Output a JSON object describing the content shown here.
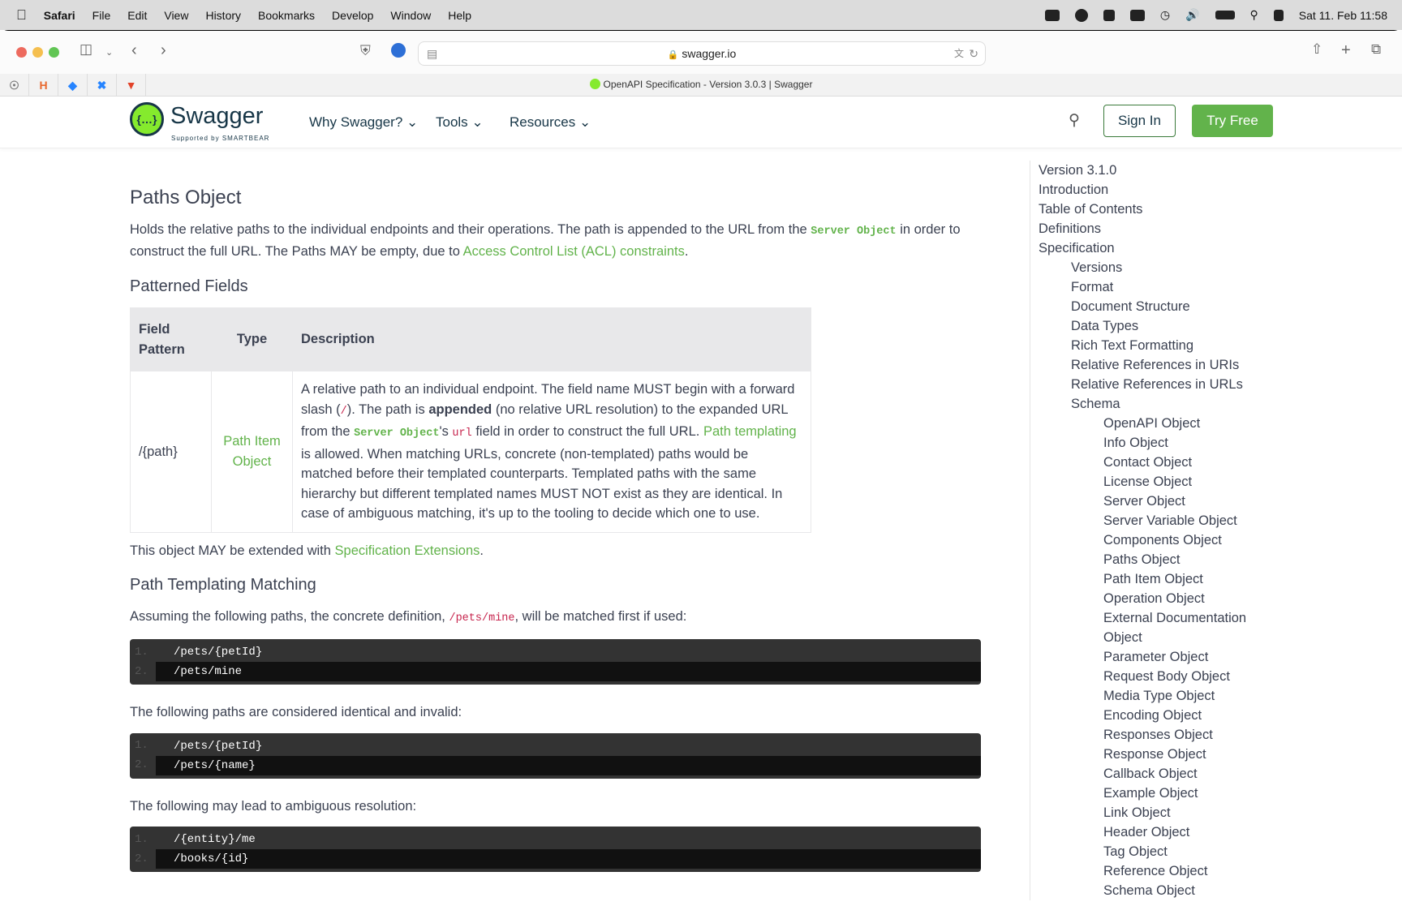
{
  "menubar": {
    "app": "Safari",
    "items": [
      "File",
      "Edit",
      "View",
      "History",
      "Bookmarks",
      "Develop",
      "Window",
      "Help"
    ],
    "datetime": "Sat 11. Feb 11:58"
  },
  "browser": {
    "url": "swagger.io",
    "tab_title": "OpenAPI Specification - Version 3.0.3 | Swagger"
  },
  "header": {
    "brand": "Swagger",
    "supported": "Supported by SMARTBEAR",
    "nav": [
      "Why Swagger?",
      "Tools",
      "Resources"
    ],
    "sign_in": "Sign In",
    "try_free": "Try Free"
  },
  "content": {
    "title": "Paths Object",
    "intro": {
      "t1": "Holds the relative paths to the individual endpoints and their operations. The path is appended to the URL from the ",
      "code1": "Server Object",
      "t2": " in order to construct the full URL. The Paths MAY be empty, due to ",
      "link": "Access Control List (ACL) constraints",
      "t3": "."
    },
    "patterned_title": "Patterned Fields",
    "table": {
      "headers": [
        "Field Pattern",
        "Type",
        "Description"
      ],
      "row": {
        "field": "/{path}",
        "type": "Path Item Object",
        "d1": "A relative path to an individual endpoint. The field name MUST begin with a forward slash (",
        "slash": "/",
        "d2": "). The path is ",
        "bold": "appended",
        "d3": " (no relative URL resolution) to the expanded URL from the ",
        "code": "Server Object",
        "d4": "'s ",
        "url": "url",
        "d5": " field in order to construct the full URL. ",
        "link": "Path templating",
        "d6": " is allowed. When matching URLs, concrete (non-templated) paths would be matched before their templated counterparts. Templated paths with the same hierarchy but different templated names MUST NOT exist as they are identical. In case of ambiguous matching, it's up to the tooling to decide which one to use."
      }
    },
    "ext": {
      "t1": "This object MAY be extended with ",
      "link": "Specification Extensions",
      "t2": "."
    },
    "templating_title": "Path Templating Matching",
    "assume": {
      "t1": "Assuming the following paths, the concrete definition, ",
      "code": "/pets/mine",
      "t2": ", will be matched first if used:"
    },
    "code1": [
      "/pets/{petId}",
      "/pets/mine"
    ],
    "identical": "The following paths are considered identical and invalid:",
    "code2": [
      "/pets/{petId}",
      "/pets/{name}"
    ],
    "ambiguous": "The following may lead to ambiguous resolution:",
    "code3": [
      "/{entity}/me",
      "/books/{id}"
    ]
  },
  "toc": {
    "top": [
      "Version 3.1.0",
      "Introduction",
      "Table of Contents",
      "Definitions",
      "Specification"
    ],
    "spec": [
      "Versions",
      "Format",
      "Document Structure",
      "Data Types",
      "Rich Text Formatting",
      "Relative References in URIs",
      "Relative References in URLs",
      "Schema"
    ],
    "schema": [
      "OpenAPI Object",
      "Info Object",
      "Contact Object",
      "License Object",
      "Server Object",
      "Server Variable Object",
      "Components Object",
      "Paths Object",
      "Path Item Object",
      "Operation Object",
      "External Documentation",
      "Object",
      "Parameter Object",
      "Request Body Object",
      "Media Type Object",
      "Encoding Object",
      "Responses Object",
      "Response Object",
      "Callback Object",
      "Example Object",
      "Link Object",
      "Header Object",
      "Tag Object",
      "Reference Object",
      "Schema Object"
    ]
  }
}
